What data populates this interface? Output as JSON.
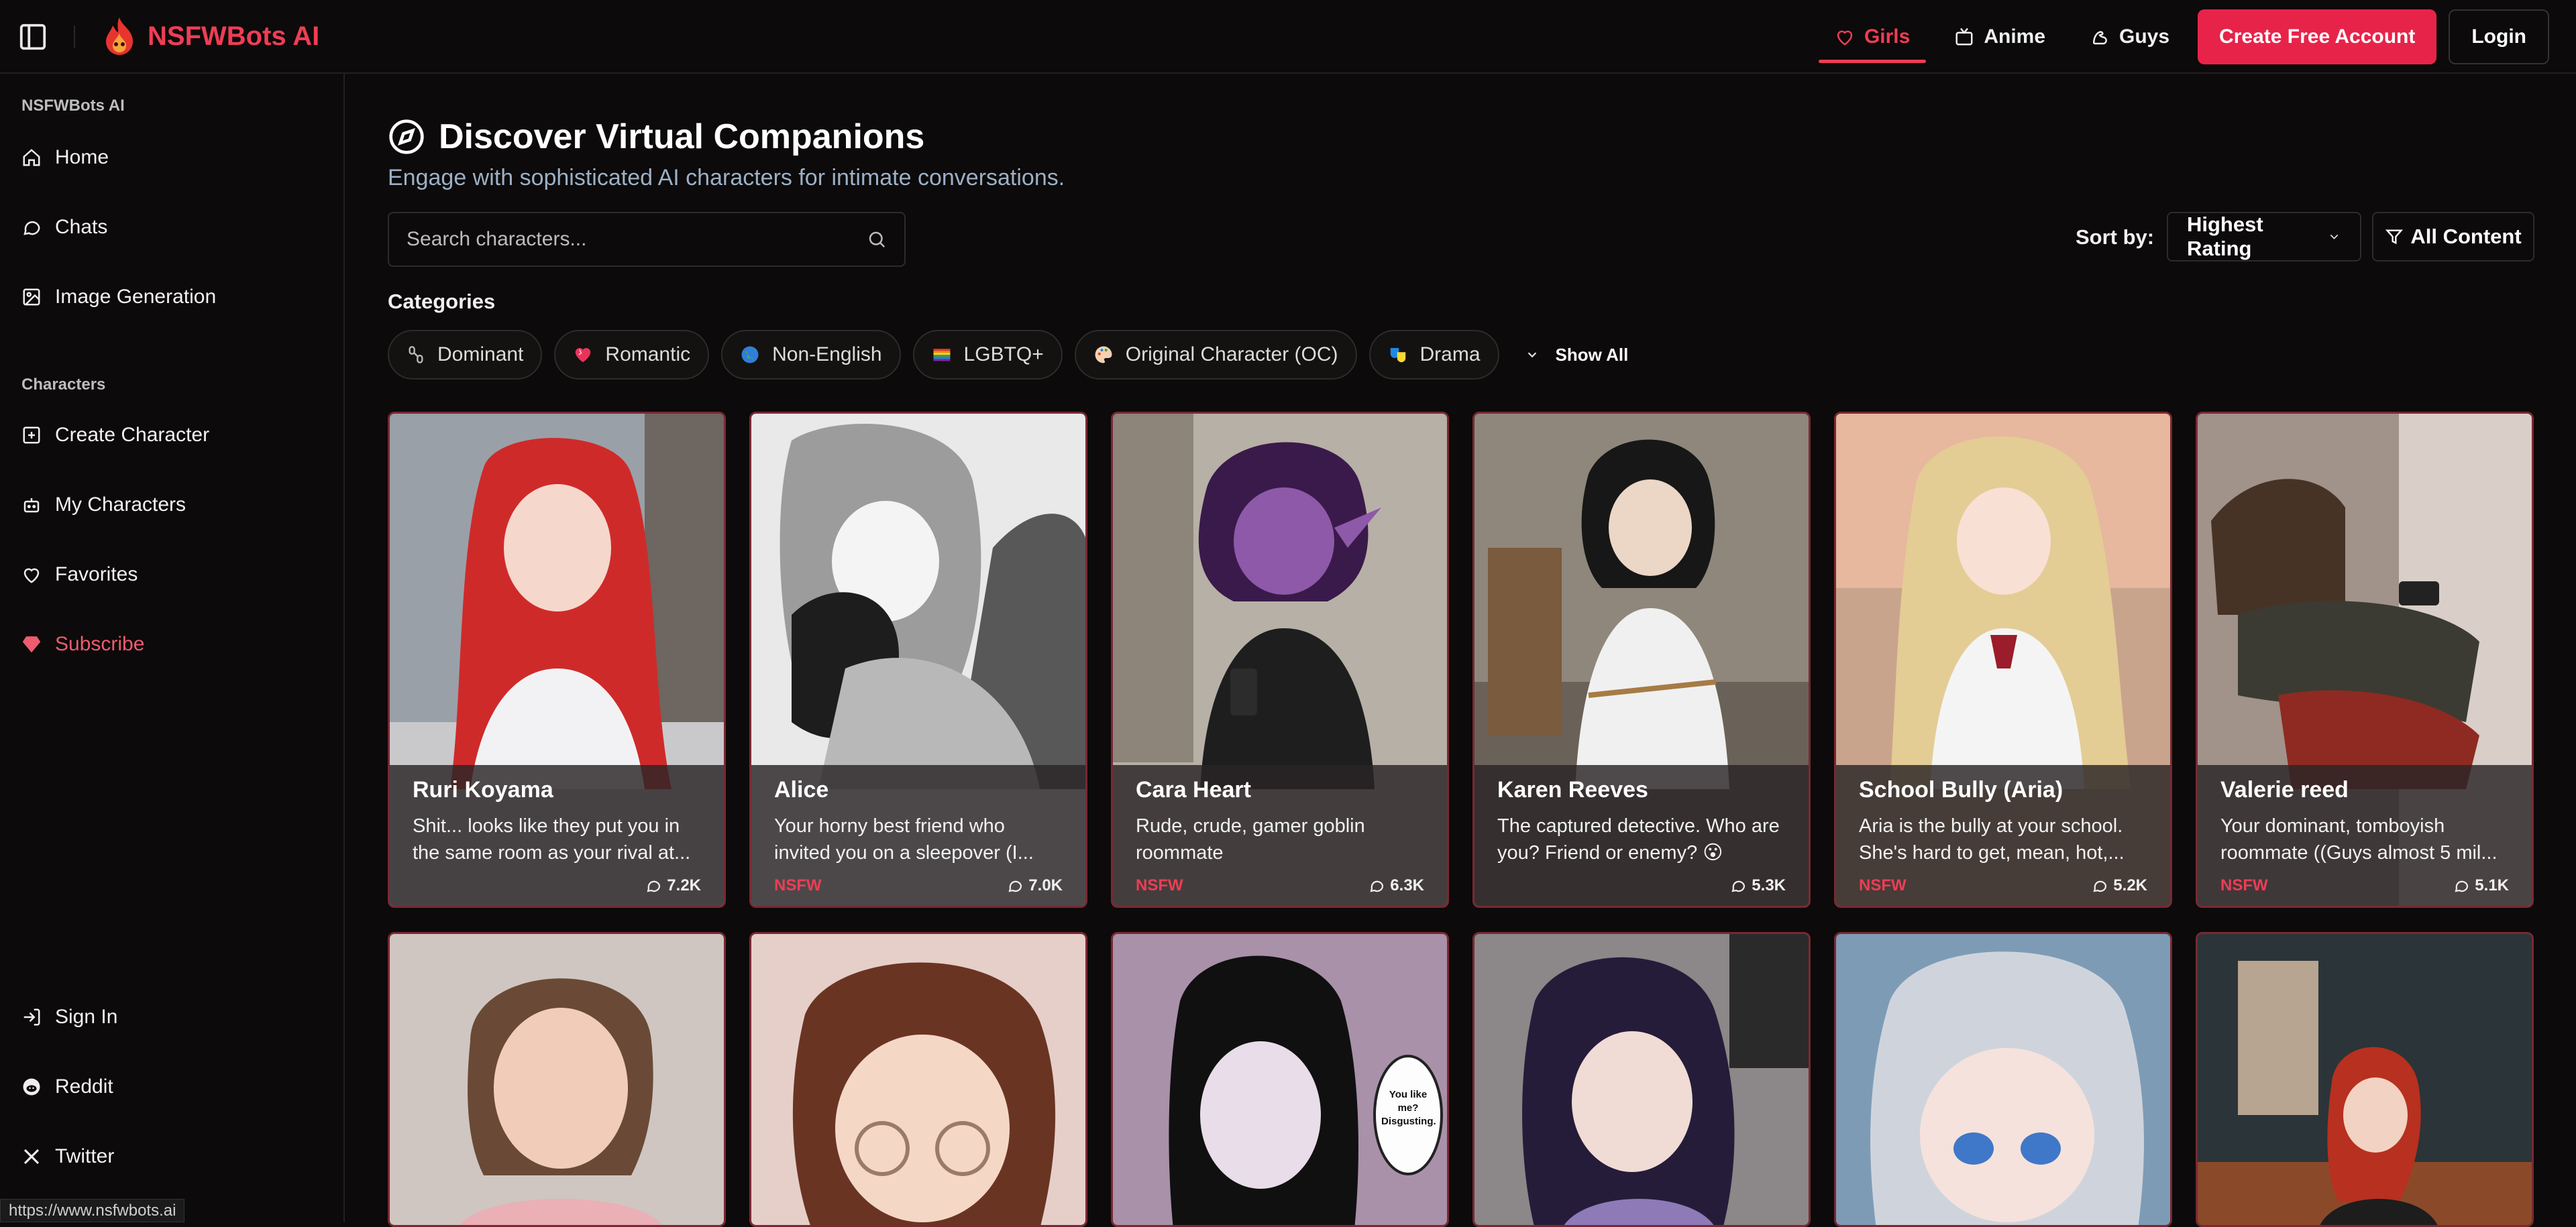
{
  "header": {
    "brand": "NSFWBots AI",
    "nav": [
      {
        "label": "Girls",
        "icon": "heart-icon",
        "active": true
      },
      {
        "label": "Anime",
        "icon": "tv-icon",
        "active": false
      },
      {
        "label": "Guys",
        "icon": "bicep-icon",
        "active": false
      }
    ],
    "create_account": "Create Free Account",
    "login": "Login"
  },
  "sidebar": {
    "section1": "NSFWBots AI",
    "items1": [
      {
        "label": "Home",
        "icon": "home-icon"
      },
      {
        "label": "Chats",
        "icon": "chat-icon"
      },
      {
        "label": "Image Generation",
        "icon": "image-icon"
      }
    ],
    "section2": "Characters",
    "items2": [
      {
        "label": "Create Character",
        "icon": "plus-square-icon"
      },
      {
        "label": "My Characters",
        "icon": "bot-icon"
      },
      {
        "label": "Favorites",
        "icon": "heart-icon"
      },
      {
        "label": "Subscribe",
        "icon": "gem-icon"
      }
    ],
    "bottom": [
      {
        "label": "Sign In",
        "icon": "sign-in-icon"
      },
      {
        "label": "Reddit",
        "icon": "reddit-icon"
      },
      {
        "label": "Twitter",
        "icon": "x-icon"
      }
    ]
  },
  "main": {
    "title": "Discover Virtual Companions",
    "subtitle": "Engage with sophisticated AI characters for intimate conversations.",
    "search_placeholder": "Search characters...",
    "sort_label": "Sort by:",
    "sort_value": "Highest Rating",
    "content_filter": "All Content",
    "categories_label": "Categories",
    "categories": [
      {
        "label": "Dominant",
        "icon": "chain-icon"
      },
      {
        "label": "Romantic",
        "icon": "heart-emoji-icon"
      },
      {
        "label": "Non-English",
        "icon": "globe-emoji-icon"
      },
      {
        "label": "LGBTQ+",
        "icon": "rainbow-flag-icon"
      },
      {
        "label": "Original Character (OC)",
        "icon": "palette-emoji-icon"
      },
      {
        "label": "Drama",
        "icon": "masks-emoji-icon"
      }
    ],
    "show_all": "Show All"
  },
  "cards": [
    {
      "name": "Ruri Koyama",
      "desc": "Shit... looks like they put you in the same room as your rival at...",
      "nsfw": "",
      "count": "7.2K"
    },
    {
      "name": "Alice",
      "desc": "Your horny best friend who invited you on a sleepover (I...",
      "nsfw": "NSFW",
      "count": "7.0K"
    },
    {
      "name": "Cara Heart",
      "desc": "Rude, crude, gamer goblin roommate",
      "nsfw": "NSFW",
      "count": "6.3K"
    },
    {
      "name": "Karen Reeves",
      "desc": "The captured detective. Who are you? Friend or enemy? 😮",
      "nsfw": "",
      "count": "5.3K"
    },
    {
      "name": "School Bully (Aria)",
      "desc": "Aria is the bully at your school. She's hard to get, mean, hot,...",
      "nsfw": "NSFW",
      "count": "5.2K"
    },
    {
      "name": "Valerie reed",
      "desc": "Your dominant, tomboyish roommate ((Guys almost 5 mil...",
      "nsfw": "NSFW",
      "count": "5.1K"
    }
  ],
  "row2_bubble": "You like me? Disgusting.",
  "status_url": "https://www.nsfwbots.ai",
  "colors": {
    "accent": "#e8234a",
    "accent_text": "#ef3d55",
    "bg": "#0c0a0a",
    "card_border": "#7a2834"
  }
}
